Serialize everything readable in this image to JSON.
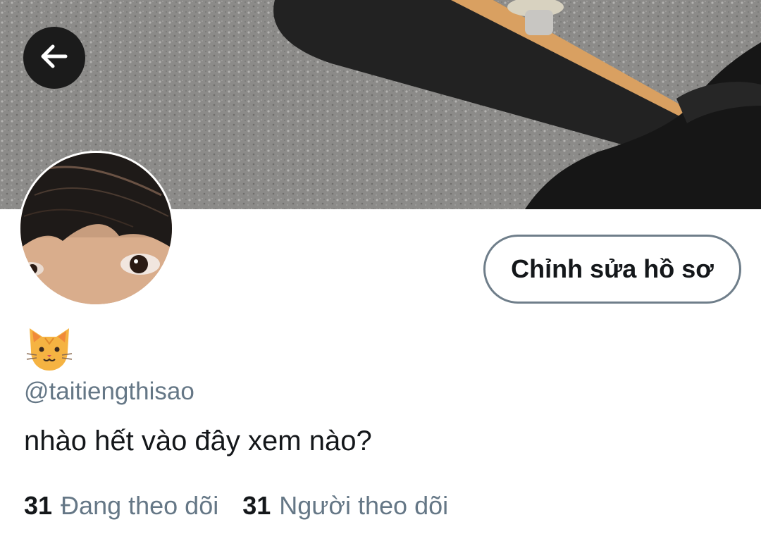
{
  "header": {
    "back_icon": "arrow-left-icon"
  },
  "profile": {
    "display_name_icon": "cat-face-emoji",
    "handle": "@taitiengthisao",
    "bio": "nhào hết vào đây xem nào?",
    "edit_button_label": "Chỉnh sửa hồ sơ"
  },
  "stats": {
    "following_count": "31",
    "following_label": "Đang theo dõi",
    "followers_count": "31",
    "followers_label": "Người theo dõi"
  },
  "colors": {
    "text_primary": "#14171a",
    "text_secondary": "#657786",
    "button_border": "#6f7e8a",
    "back_button_bg": "#1b1b1b"
  }
}
